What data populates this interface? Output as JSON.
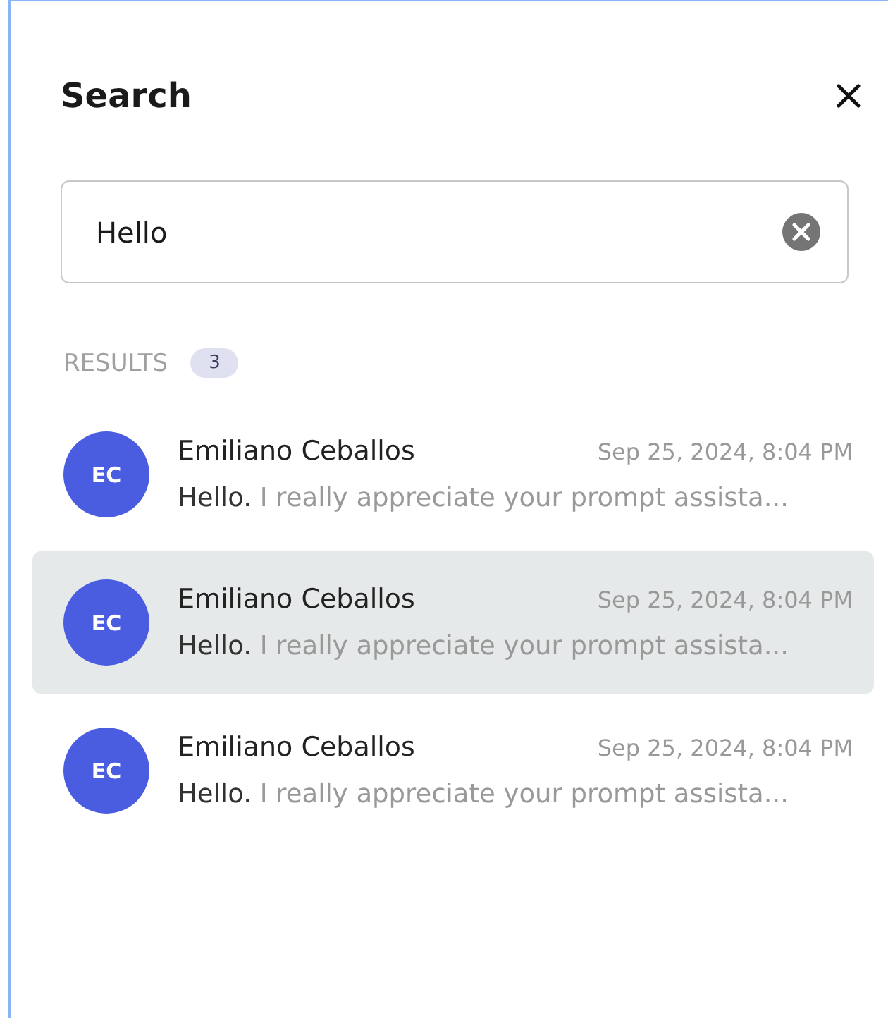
{
  "header": {
    "title": "Search"
  },
  "search": {
    "value": "Hello"
  },
  "results": {
    "label": "RESULTS",
    "count": "3",
    "items": [
      {
        "initials": "EC",
        "name": "Emiliano Ceballos",
        "time": "Sep 25, 2024, 8:04 PM",
        "match": "Hello.",
        "preview": "I really appreciate your prompt assista...",
        "selected": false
      },
      {
        "initials": "EC",
        "name": "Emiliano Ceballos",
        "time": "Sep 25, 2024, 8:04 PM",
        "match": "Hello.",
        "preview": "I really appreciate your prompt assista...",
        "selected": true
      },
      {
        "initials": "EC",
        "name": "Emiliano Ceballos",
        "time": "Sep 25, 2024, 8:04 PM",
        "match": "Hello.",
        "preview": "I really appreciate your prompt assista...",
        "selected": false
      }
    ]
  }
}
